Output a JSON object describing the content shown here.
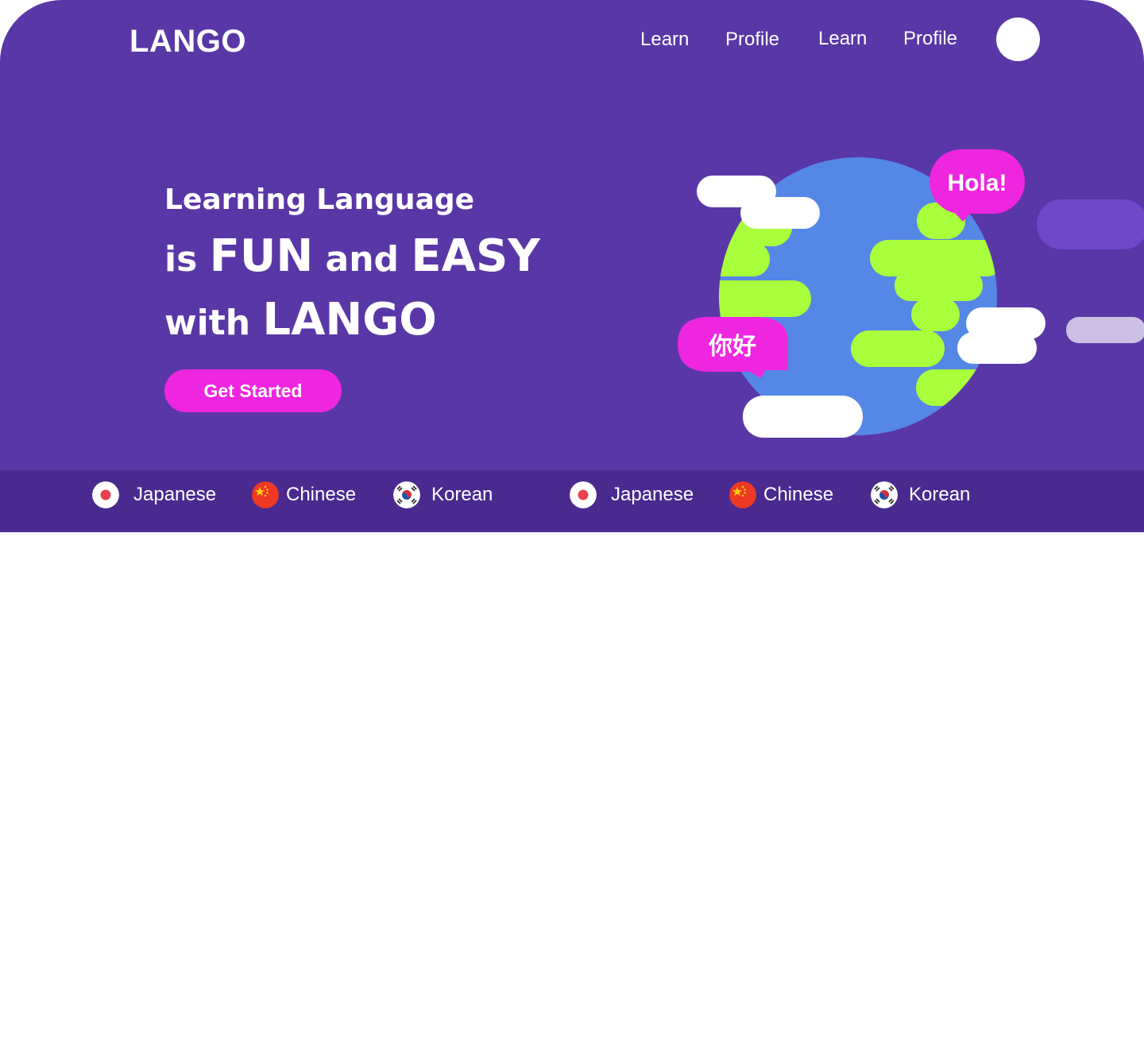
{
  "brand": {
    "logo": "LANGO"
  },
  "nav": {
    "items": [
      {
        "label": "Learn"
      },
      {
        "label": "Profile"
      },
      {
        "label": "Learn"
      },
      {
        "label": "Profile"
      }
    ]
  },
  "hero": {
    "line1": "Learning Language",
    "line2_pre": "is ",
    "line2_big1": "FUN",
    "line2_mid": " and ",
    "line2_big2": "EASY",
    "line3_pre": "with ",
    "line3_big": "LANGO",
    "cta_label": "Get Started",
    "bubble_spanish": "Hola!",
    "bubble_chinese": "你好"
  },
  "languages": [
    {
      "label": "Japanese",
      "flag": "japan-flag-icon"
    },
    {
      "label": "Chinese",
      "flag": "china-flag-icon"
    },
    {
      "label": "Korean",
      "flag": "korea-flag-icon"
    },
    {
      "label": "Japanese",
      "flag": "japan-flag-icon"
    },
    {
      "label": "Chinese",
      "flag": "china-flag-icon"
    },
    {
      "label": "Korean",
      "flag": "korea-flag-icon"
    }
  ],
  "colors": {
    "hero_bg": "#5a37a6",
    "bar_bg": "#4a2a8f",
    "accent_pink": "#ef26df",
    "globe_blue": "#5587e6",
    "land_green": "#aaff3c"
  }
}
